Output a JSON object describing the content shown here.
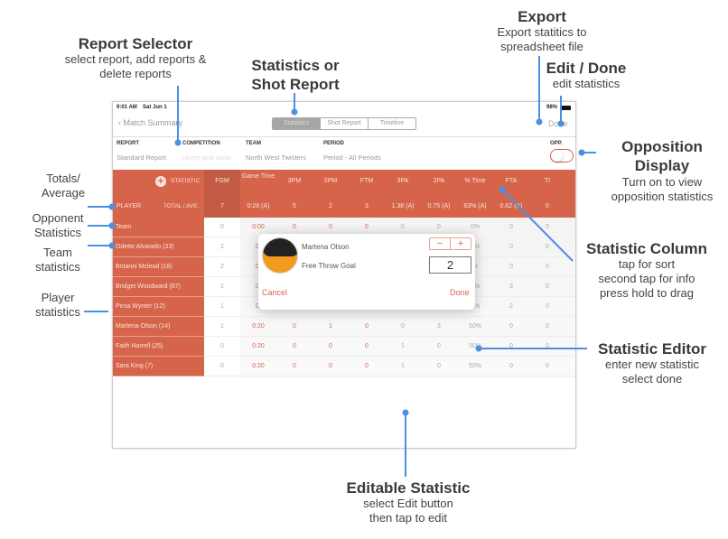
{
  "annotations": {
    "report_selector": {
      "title": "Report Selector",
      "lines": [
        "select report, add reports &",
        "delete reports"
      ]
    },
    "stats_or_shot": {
      "title": [
        "Statistics or",
        "Shot Report"
      ]
    },
    "export": {
      "title": "Export",
      "lines": [
        "Export statitics to",
        "spreadsheet file"
      ]
    },
    "edit_done": {
      "title": "Edit / Done",
      "lines": [
        "edit statistics"
      ]
    },
    "opposition": {
      "title": [
        "Opposition",
        "Display"
      ],
      "lines": [
        "Turn on to view",
        "opposition statistics"
      ]
    },
    "totals": {
      "title": [
        "Totals/",
        "Average"
      ]
    },
    "opponent": {
      "title": [
        "Opponent",
        "Statistics"
      ]
    },
    "team": {
      "title": [
        "Team",
        "statistics"
      ]
    },
    "player": {
      "title": [
        "Player",
        "statistics"
      ]
    },
    "stat_column": {
      "title": "Statistic Column",
      "lines": [
        "tap for sort",
        "second tap for info",
        "press hold to drag"
      ]
    },
    "stat_editor": {
      "title": "Statistic Editor",
      "lines": [
        "enter new statistic",
        "select done"
      ]
    },
    "editable": {
      "title": "Editable Statistic",
      "lines": [
        "select Edit button",
        "then tap to edit"
      ]
    }
  },
  "accent": "#d6644a",
  "app": {
    "status": {
      "time": "9:01 AM",
      "date": "Sat Jun 1",
      "battery": "98%"
    },
    "nav": {
      "back": "Match Summary",
      "tabs": [
        "Statistics",
        "Shot Report",
        "Timeline"
      ],
      "selected_tab": "Statistics",
      "done": "Done"
    },
    "filters": [
      {
        "label": "REPORT",
        "value": "Standard Report"
      },
      {
        "label": "COMPETITION",
        "value": "Home and away"
      },
      {
        "label": "TEAM",
        "value": "North West Twisters"
      },
      {
        "label": "PERIOD",
        "value": "Period - All Periods"
      }
    ],
    "opp": {
      "label": "OPP.",
      "on": false
    },
    "table": {
      "statistic_label": "STATISTIC",
      "player_label": "PLAYER",
      "total_label": "TOTAL / AVE.",
      "columns": [
        "FGM",
        "Game Time",
        "3PM",
        "2PM",
        "FTM",
        "3PA",
        "2PA",
        "% Time",
        "FTA",
        "TI"
      ],
      "totals": [
        "7",
        "0:28 (A)",
        "5",
        "2",
        "3",
        "1.38 (A)",
        "0.75 (A)",
        "63% (A)",
        "0.62 (A)",
        "0"
      ],
      "rows": [
        {
          "name": "Team",
          "values": [
            "0",
            "0:00",
            "0",
            "0",
            "0",
            "0",
            "0",
            "0%",
            "0",
            "0"
          ]
        },
        {
          "name": "Odette Alvarado (33)",
          "values": [
            "2",
            "0:",
            "",
            "",
            "",
            "",
            "",
            "0%",
            "0",
            "0"
          ]
        },
        {
          "name": "Britanni Mcleod (18)",
          "values": [
            "2",
            "0:",
            "",
            "",
            "",
            "",
            "",
            "%",
            "0",
            "0"
          ]
        },
        {
          "name": "Bridget Woodward (67)",
          "values": [
            "1",
            "0:",
            "",
            "",
            "",
            "",
            "",
            "0%",
            "3",
            "0"
          ]
        },
        {
          "name": "Pena Wynter (12)",
          "values": [
            "1",
            "0:",
            "",
            "",
            "",
            "",
            "",
            "0%",
            "2",
            "0"
          ]
        },
        {
          "name": "Martena Olson (14)",
          "values": [
            "1",
            "0:20",
            "0",
            "1",
            "0",
            "0",
            "3",
            "50%",
            "0",
            "0"
          ]
        },
        {
          "name": "Faith Harrell (25)",
          "values": [
            "0",
            "0:20",
            "0",
            "0",
            "0",
            "1",
            "0",
            "50%",
            "0",
            "0"
          ]
        },
        {
          "name": "Sara King (7)",
          "values": [
            "0",
            "0:20",
            "0",
            "0",
            "0",
            "1",
            "0",
            "50%",
            "0",
            "0"
          ]
        }
      ]
    },
    "editor": {
      "player": "Martena Olson",
      "statistic": "Free Throw Goal",
      "value": "2",
      "minus": "−",
      "plus": "+",
      "cancel": "Cancel",
      "done": "Done"
    }
  }
}
